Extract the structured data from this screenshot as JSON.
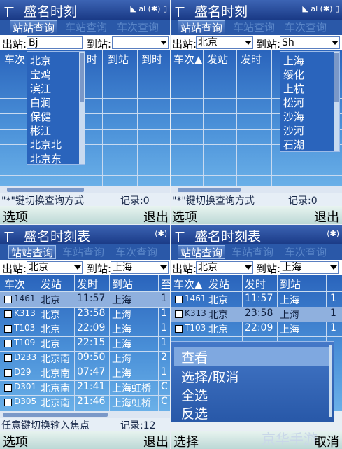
{
  "status_icons": {
    "signal": "◣",
    "net": "al",
    "star": "(✱)",
    "battery": "▯"
  },
  "q1": {
    "app_title": "盛名时刻",
    "tabs": [
      "站站查询",
      "车站查询",
      "车次查询"
    ],
    "from_label": "出站:",
    "from_value": "Bj",
    "to_label": "到站:",
    "to_value": "",
    "columns": [
      "车次",
      "时",
      "到站",
      "到时"
    ],
    "dropdown": [
      "北京",
      "宝鸡",
      "滨江",
      "白涧",
      "保健",
      "彬江",
      "北京北",
      "北京东"
    ],
    "hint": "\"*\"键切换查询方式",
    "record": "记录:0",
    "left_soft": "选项",
    "right_soft": "退出"
  },
  "q2": {
    "app_title": "盛名时刻",
    "tabs": [
      "站站查询",
      "车站查询",
      "车次查询"
    ],
    "from_label": "出站:",
    "from_value": "北京",
    "to_label": "到站:",
    "to_value": "Sh",
    "columns": [
      "车次▲",
      "发站",
      "发时"
    ],
    "dropdown": [
      "上海",
      "绥化",
      "上杭",
      "松河",
      "沙海",
      "沙河",
      "石湖"
    ],
    "hint": "\"*\"键切换查询方式",
    "record": "记录:0",
    "left_soft": "选项",
    "right_soft": "退出"
  },
  "q3": {
    "app_title": "盛名时刻表",
    "tabs": [
      "站站查询",
      "车站查询",
      "车次查询"
    ],
    "from_label": "出站:",
    "from_value": "北京",
    "to_label": "到站:",
    "to_value": "上海",
    "columns": [
      "车次",
      "发站",
      "发时",
      "到站",
      "至"
    ],
    "rows": [
      [
        "1461",
        "北京",
        "11:57",
        "上海",
        "1"
      ],
      [
        "K313",
        "北京",
        "23:58",
        "上海",
        "1"
      ],
      [
        "T103",
        "北京",
        "22:09",
        "上海",
        "1"
      ],
      [
        "T109",
        "北京",
        "22:15",
        "上海",
        "1"
      ],
      [
        "D233",
        "北京南",
        "09:50",
        "上海",
        "2"
      ],
      [
        "D29",
        "北京南",
        "07:47",
        "上海",
        "1"
      ],
      [
        "D301",
        "北京南",
        "21:41",
        "上海虹桥",
        "C"
      ],
      [
        "D305",
        "北京南",
        "21:46",
        "上海虹桥",
        "C"
      ]
    ],
    "hint": "任意键切换输入焦点",
    "record": "记录:12",
    "left_soft": "选项",
    "right_soft": "退出"
  },
  "q4": {
    "app_title": "盛名时刻表",
    "tabs": [
      "站站查询",
      "车站查询",
      "车次查询"
    ],
    "from_label": "出站:",
    "from_value": "北京",
    "to_label": "到站:",
    "to_value": "上海",
    "columns": [
      "车次▲",
      "发站",
      "发时",
      "到站"
    ],
    "rows": [
      [
        "1461",
        "北京",
        "11:57",
        "上海",
        "1"
      ],
      [
        "K313",
        "北京",
        "23:58",
        "上海",
        "1"
      ],
      [
        "T103",
        "北京",
        "22:09",
        "上海",
        "1"
      ]
    ],
    "menu": [
      "查看",
      "选择/取消",
      "全选",
      "反选"
    ],
    "left_soft": "选择",
    "right_soft": "取消",
    "watermark": "京华手游"
  }
}
